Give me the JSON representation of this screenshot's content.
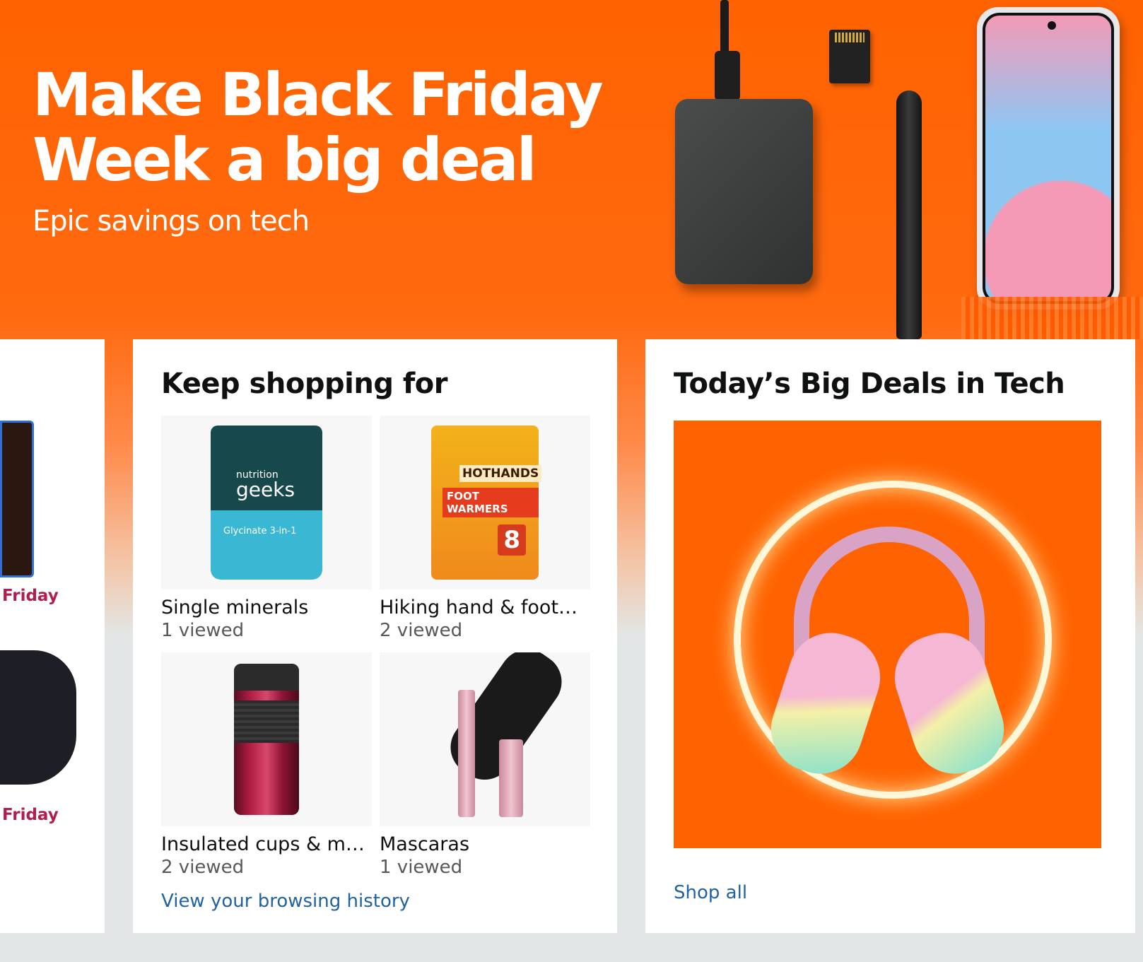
{
  "hero": {
    "title": "Make Black Friday\nWeek a big deal",
    "subtitle": "Epic savings on tech"
  },
  "left_card": {
    "labels": [
      "Friday",
      "Friday"
    ]
  },
  "keep_shopping": {
    "title": "Keep shopping for",
    "items": [
      {
        "label": "Single minerals",
        "count": "1 viewed",
        "brand_top": "nutrition",
        "brand_main": "geeks",
        "product": "Glycinate 3-in-1"
      },
      {
        "label": "Hiking hand & foot…",
        "count": "2 viewed",
        "brand": "HOTHANDS",
        "product": "FOOT WARMERS",
        "badge": "8"
      },
      {
        "label": "Insulated cups & mugs",
        "count": "2 viewed"
      },
      {
        "label": "Mascaras",
        "count": "1 viewed"
      }
    ],
    "link": "View your browsing history"
  },
  "deals": {
    "title": "Today’s Big Deals in Tech",
    "link": "Shop all"
  },
  "colors": {
    "hero_orange": "#ff6200",
    "link_blue": "#2162a1",
    "friday_red": "#b11e4b"
  }
}
